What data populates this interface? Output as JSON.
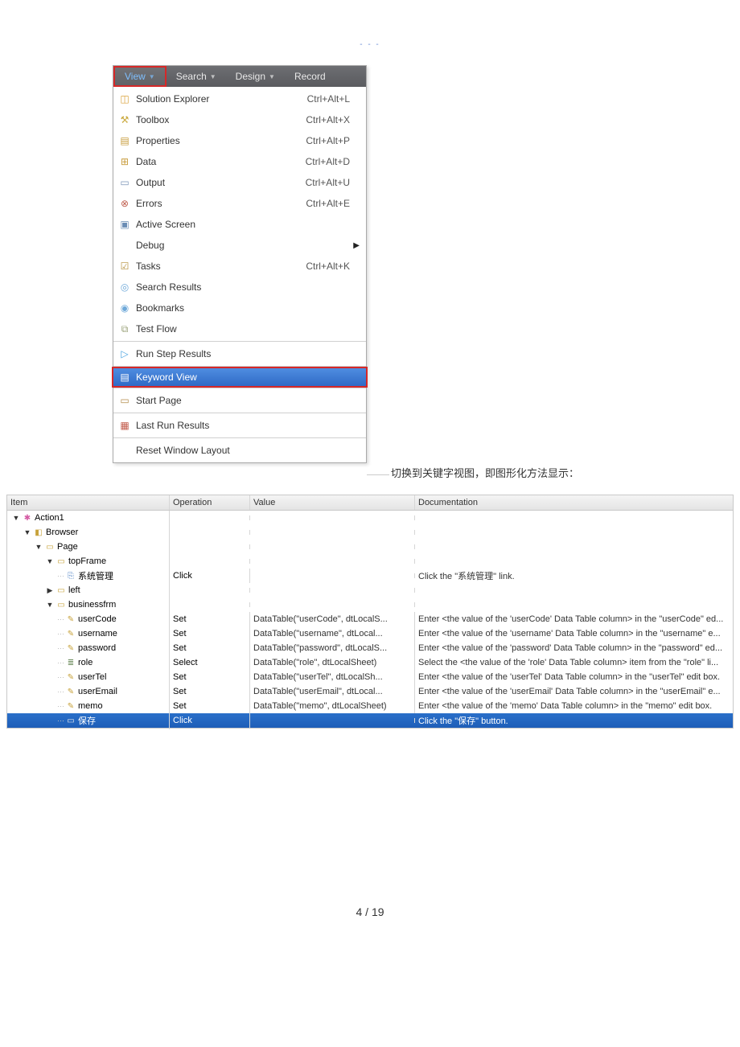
{
  "header_dots": "- - -",
  "menu_bar": {
    "view": "View",
    "search": "Search",
    "design": "Design",
    "record": "Record"
  },
  "menu_items": {
    "solution_explorer": {
      "label": "Solution Explorer",
      "shortcut": "Ctrl+Alt+L"
    },
    "toolbox": {
      "label": "Toolbox",
      "shortcut": "Ctrl+Alt+X"
    },
    "properties": {
      "label": "Properties",
      "shortcut": "Ctrl+Alt+P"
    },
    "data": {
      "label": "Data",
      "shortcut": "Ctrl+Alt+D"
    },
    "output": {
      "label": "Output",
      "shortcut": "Ctrl+Alt+U"
    },
    "errors": {
      "label": "Errors",
      "shortcut": "Ctrl+Alt+E"
    },
    "active_screen": {
      "label": "Active Screen",
      "shortcut": ""
    },
    "debug": {
      "label": "Debug",
      "shortcut": ""
    },
    "tasks": {
      "label": "Tasks",
      "shortcut": "Ctrl+Alt+K"
    },
    "search_results": {
      "label": "Search Results",
      "shortcut": ""
    },
    "bookmarks": {
      "label": "Bookmarks",
      "shortcut": ""
    },
    "test_flow": {
      "label": "Test Flow",
      "shortcut": ""
    },
    "run_step_results": {
      "label": "Run Step Results",
      "shortcut": ""
    },
    "keyword_view": {
      "label": "Keyword View",
      "shortcut": ""
    },
    "start_page": {
      "label": "Start Page",
      "shortcut": ""
    },
    "last_run_results": {
      "label": "Last Run Results",
      "shortcut": ""
    },
    "reset_window_layout": {
      "label": "Reset Window Layout",
      "shortcut": ""
    }
  },
  "caption": "切换到关键字视图，即图形化方法显示：",
  "grid": {
    "headers": {
      "item": "Item",
      "operation": "Operation",
      "value": "Value",
      "documentation": "Documentation"
    },
    "rows": [
      {
        "indent": 0,
        "expander": "▼",
        "icon": "ic-action",
        "glyph": "✱",
        "item": "Action1",
        "op": "",
        "val": "",
        "doc": ""
      },
      {
        "indent": 1,
        "expander": "▼",
        "icon": "ic-browser",
        "glyph": "◧",
        "item": "Browser",
        "op": "",
        "val": "",
        "doc": ""
      },
      {
        "indent": 2,
        "expander": "▼",
        "icon": "ic-page",
        "glyph": "▭",
        "item": "Page",
        "op": "",
        "val": "",
        "doc": ""
      },
      {
        "indent": 3,
        "expander": "▼",
        "icon": "ic-frame",
        "glyph": "▭",
        "item": "topFrame",
        "op": "",
        "val": "",
        "doc": ""
      },
      {
        "indent": 4,
        "expander": "",
        "icon": "ic-link",
        "glyph": "⎘",
        "item": "系统管理",
        "op": "Click",
        "val": "",
        "doc": "Click the \"系统管理\" link."
      },
      {
        "indent": 3,
        "expander": "▶",
        "icon": "ic-frame",
        "glyph": "▭",
        "item": "left",
        "op": "",
        "val": "",
        "doc": ""
      },
      {
        "indent": 3,
        "expander": "▼",
        "icon": "ic-frame",
        "glyph": "▭",
        "item": "businessfrm",
        "op": "",
        "val": "",
        "doc": ""
      },
      {
        "indent": 4,
        "expander": "",
        "icon": "ic-edit",
        "glyph": "✎",
        "item": "userCode",
        "op": "Set",
        "val": "DataTable(\"userCode\", dtLocalS...",
        "doc": "Enter <the value of the 'userCode' Data Table column> in the \"userCode\" ed..."
      },
      {
        "indent": 4,
        "expander": "",
        "icon": "ic-edit",
        "glyph": "✎",
        "item": "username",
        "op": "Set",
        "val": "DataTable(\"username\", dtLocal...",
        "doc": "Enter <the value of the 'username' Data Table column> in the \"username\" e..."
      },
      {
        "indent": 4,
        "expander": "",
        "icon": "ic-edit",
        "glyph": "✎",
        "item": "password",
        "op": "Set",
        "val": "DataTable(\"password\", dtLocalS...",
        "doc": "Enter <the value of the 'password' Data Table column> in the \"password\" ed..."
      },
      {
        "indent": 4,
        "expander": "",
        "icon": "ic-list",
        "glyph": "≣",
        "item": "role",
        "op": "Select",
        "val": "DataTable(\"role\", dtLocalSheet)",
        "doc": "Select the <the value of the 'role' Data Table column> item from the \"role\" li..."
      },
      {
        "indent": 4,
        "expander": "",
        "icon": "ic-edit",
        "glyph": "✎",
        "item": "userTel",
        "op": "Set",
        "val": "DataTable(\"userTel\", dtLocalSh...",
        "doc": "Enter <the value of the 'userTel' Data Table column> in the \"userTel\" edit box."
      },
      {
        "indent": 4,
        "expander": "",
        "icon": "ic-edit",
        "glyph": "✎",
        "item": "userEmail",
        "op": "Set",
        "val": "DataTable(\"userEmail\", dtLocal...",
        "doc": "Enter <the value of the 'userEmail' Data Table column> in the \"userEmail\" e..."
      },
      {
        "indent": 4,
        "expander": "",
        "icon": "ic-edit",
        "glyph": "✎",
        "item": "memo",
        "op": "Set",
        "val": "DataTable(\"memo\", dtLocalSheet)",
        "doc": "Enter <the value of the 'memo' Data Table column> in the \"memo\" edit box."
      },
      {
        "indent": 4,
        "expander": "",
        "icon": "ic-btn",
        "glyph": "▭",
        "item": "保存",
        "op": "Click",
        "val": "",
        "doc": "Click the \"保存\" button.",
        "selected": true
      }
    ]
  },
  "footer": "4  /  19"
}
